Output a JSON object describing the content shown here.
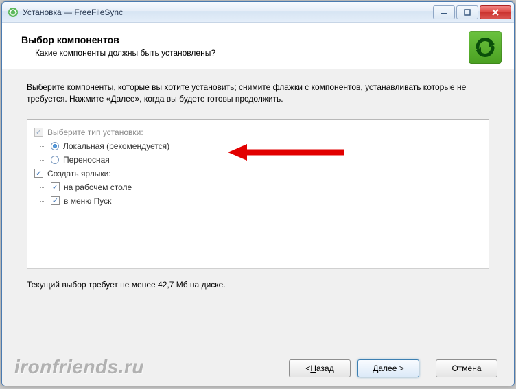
{
  "window": {
    "title": "Установка — FreeFileSync"
  },
  "header": {
    "title": "Выбор компонентов",
    "subtitle": "Какие компоненты должны быть установлены?"
  },
  "intro": "Выберите компоненты, которые вы хотите установить; снимите флажки с компонентов, устанавливать которые не требуется. Нажмите «Далее», когда вы будете готовы продолжить.",
  "tree": {
    "root_label": "Выберите тип установки:",
    "install_type": {
      "local": "Локальная (рекомендуется)",
      "portable": "Переносная"
    },
    "shortcuts_label": "Создать ярлыки:",
    "shortcuts": {
      "desktop": "на рабочем столе",
      "startmenu": "в меню Пуск"
    }
  },
  "disk_req": "Текущий выбор требует не менее 42,7 Мб на диске.",
  "buttons": {
    "back_pre": "< ",
    "back_u": "Н",
    "back_post": "азад",
    "next_u": "Д",
    "next_post": "алее >",
    "cancel": "Отмена"
  },
  "watermark": "ironfriends.ru"
}
